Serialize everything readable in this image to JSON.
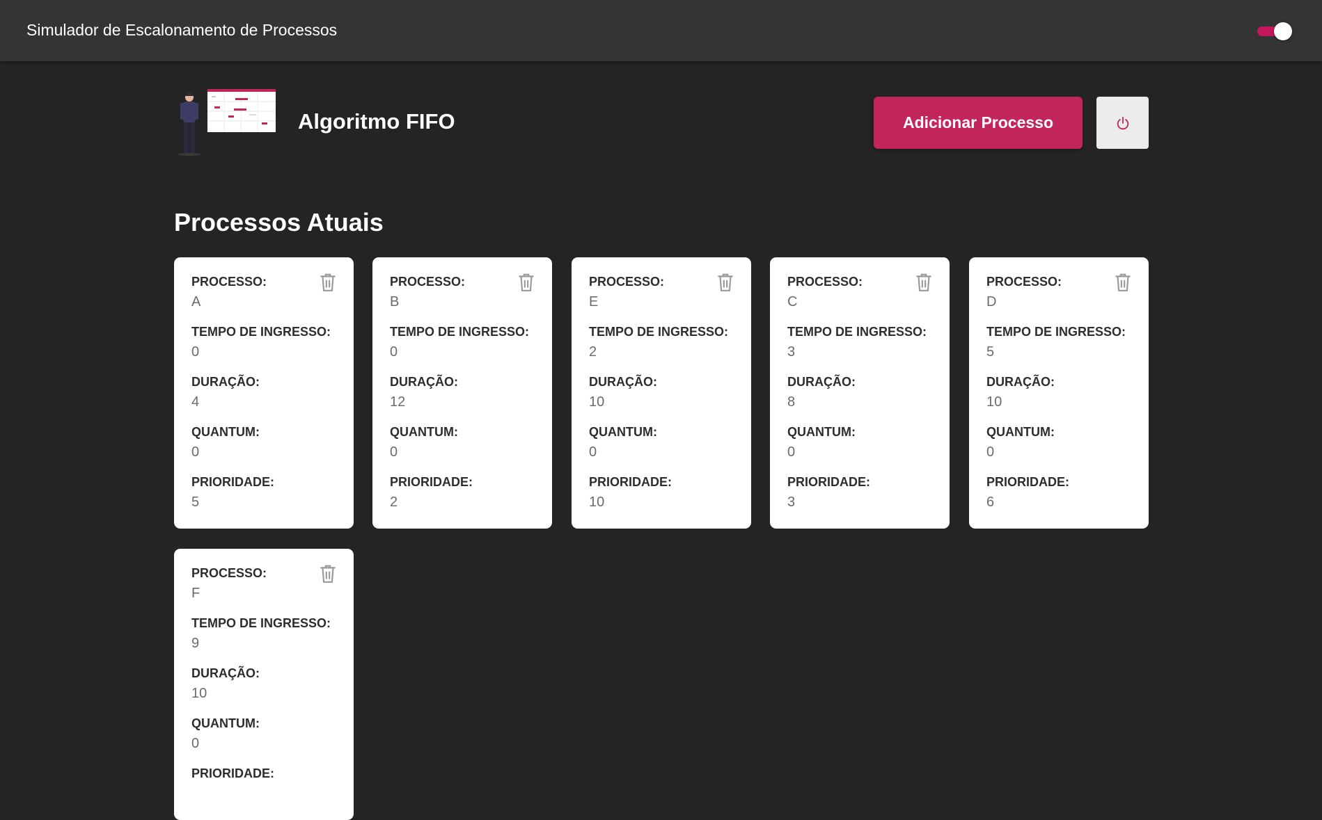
{
  "appbar": {
    "title": "Simulador de Escalonamento de Processos",
    "theme_toggle_on": true
  },
  "header": {
    "algorithm_title": "Algoritmo FIFO",
    "add_button_label": "Adicionar Processo",
    "power_icon": "power-icon"
  },
  "section": {
    "title": "Processos Atuais"
  },
  "labels": {
    "process": "PROCESSO:",
    "arrival": "TEMPO DE INGRESSO:",
    "duration": "DURAÇÃO:",
    "quantum": "QUANTUM:",
    "priority": "PRIORIDADE:"
  },
  "processes": [
    {
      "name": "A",
      "arrival": "0",
      "duration": "4",
      "quantum": "0",
      "priority": "5"
    },
    {
      "name": "B",
      "arrival": "0",
      "duration": "12",
      "quantum": "0",
      "priority": "2"
    },
    {
      "name": "E",
      "arrival": "2",
      "duration": "10",
      "quantum": "0",
      "priority": "10"
    },
    {
      "name": "C",
      "arrival": "3",
      "duration": "8",
      "quantum": "0",
      "priority": "3"
    },
    {
      "name": "D",
      "arrival": "5",
      "duration": "10",
      "quantum": "0",
      "priority": "6"
    },
    {
      "name": "F",
      "arrival": "9",
      "duration": "10",
      "quantum": "0",
      "priority": ""
    }
  ],
  "colors": {
    "accent": "#c2255c",
    "background": "#242424",
    "appbar": "#343434"
  }
}
